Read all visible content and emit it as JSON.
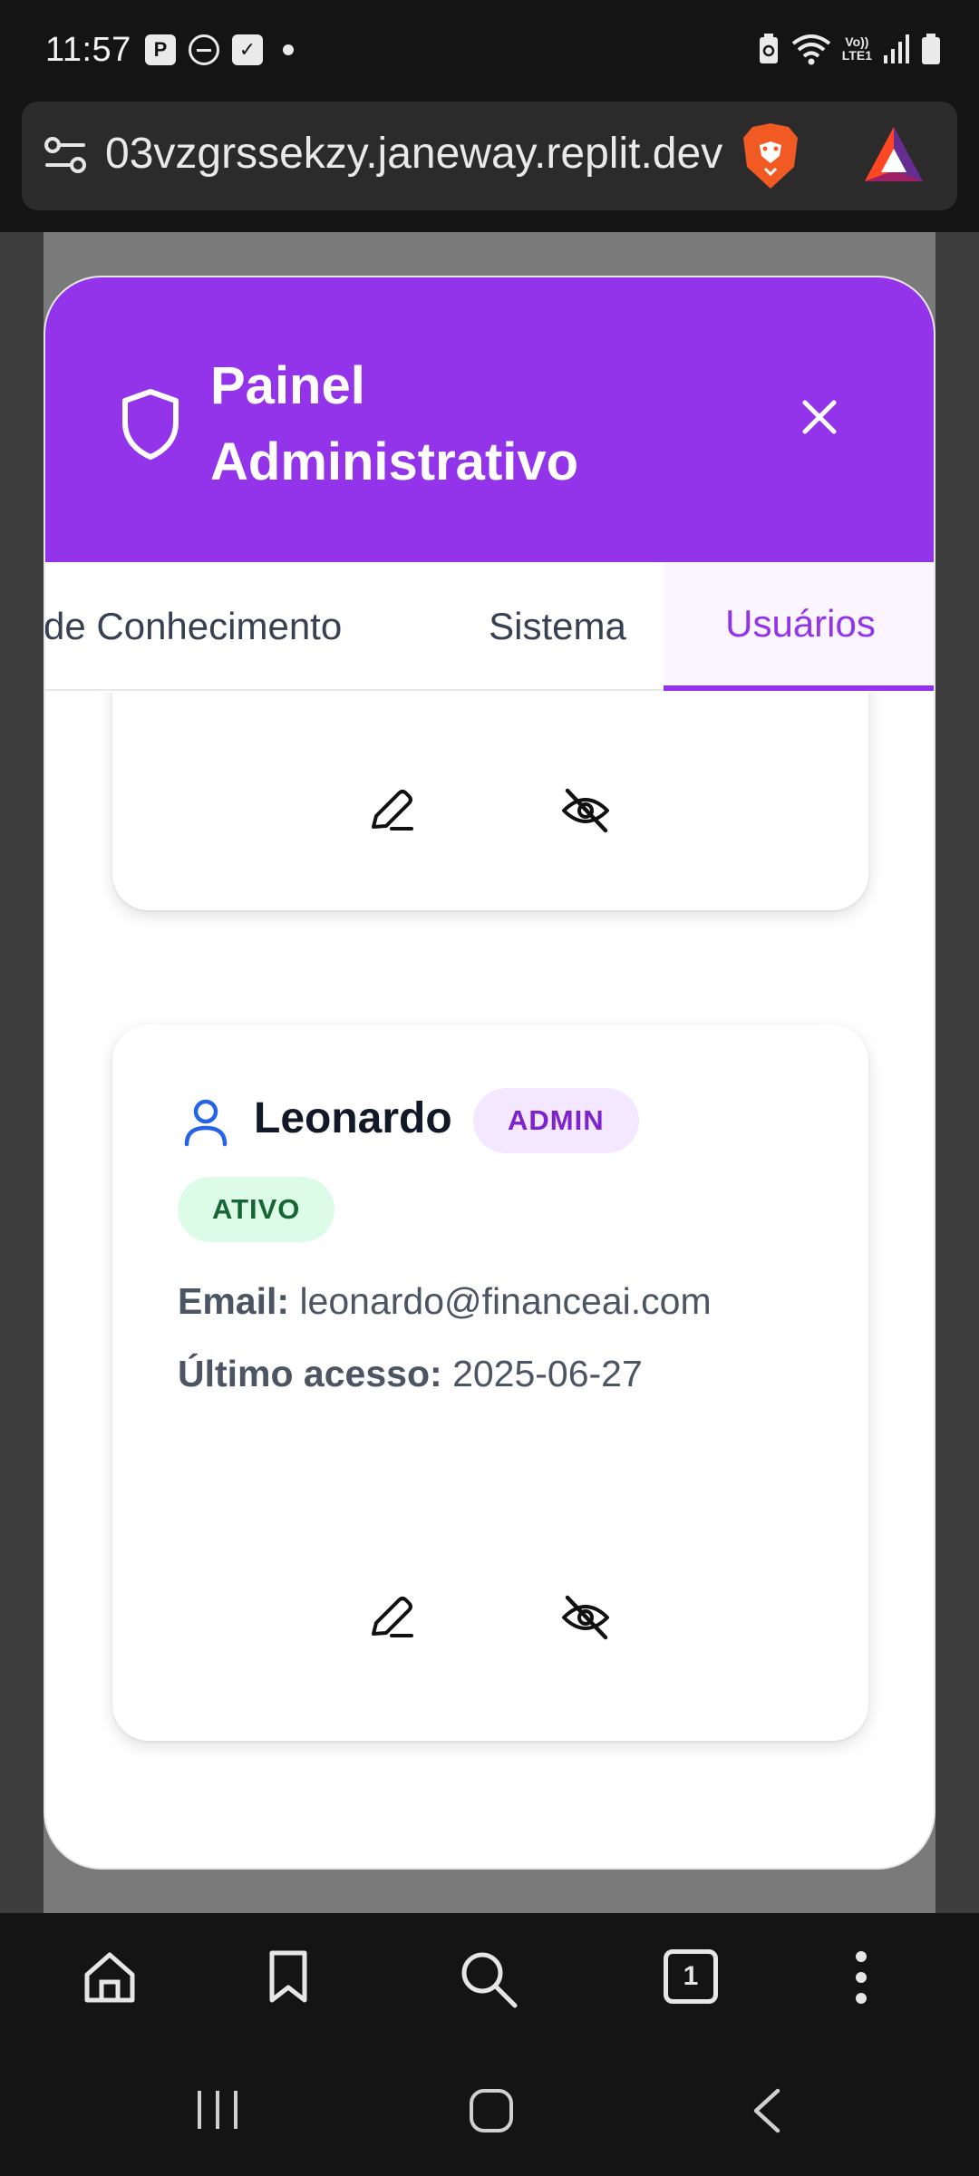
{
  "status_bar": {
    "time": "11:57",
    "left_icons": [
      "parking-notification-icon",
      "do-not-disturb-icon",
      "task-check-icon",
      "notification-dot-icon"
    ],
    "right_icons": [
      "battery-saver-icon",
      "wifi-icon",
      "volte-lte-icon",
      "signal-icon",
      "battery-icon"
    ],
    "lte_label_top": "Vo))",
    "lte_label_bottom": "LTE1"
  },
  "browser": {
    "url": "03vzgrssekzy.janeway.replit.dev",
    "icons": [
      "site-settings-icon",
      "brave-shields-icon",
      "brave-rewards-icon"
    ]
  },
  "modal": {
    "title": "Painel Administrativo",
    "tabs": [
      {
        "label": "Base de Conhecimento",
        "visible_label": "de Conhecimento",
        "active": false
      },
      {
        "label": "Sistema",
        "active": false
      },
      {
        "label": "Usuários",
        "active": true
      }
    ],
    "users": [
      {
        "name": "Leonardo",
        "role_badge": "ADMIN",
        "status_badge": "ATIVO",
        "email_label": "Email:",
        "email": "leonardo@financeai.com",
        "last_access_label": "Último acesso:",
        "last_access": "2025-06-27"
      }
    ]
  },
  "bottom_toolbar": {
    "tab_count": "1"
  },
  "colors": {
    "accent": "#9333ea",
    "admin_badge_bg": "#f3e8ff",
    "admin_badge_text": "#7e22ce",
    "active_badge_bg": "#dcfce7",
    "active_badge_text": "#166534"
  }
}
